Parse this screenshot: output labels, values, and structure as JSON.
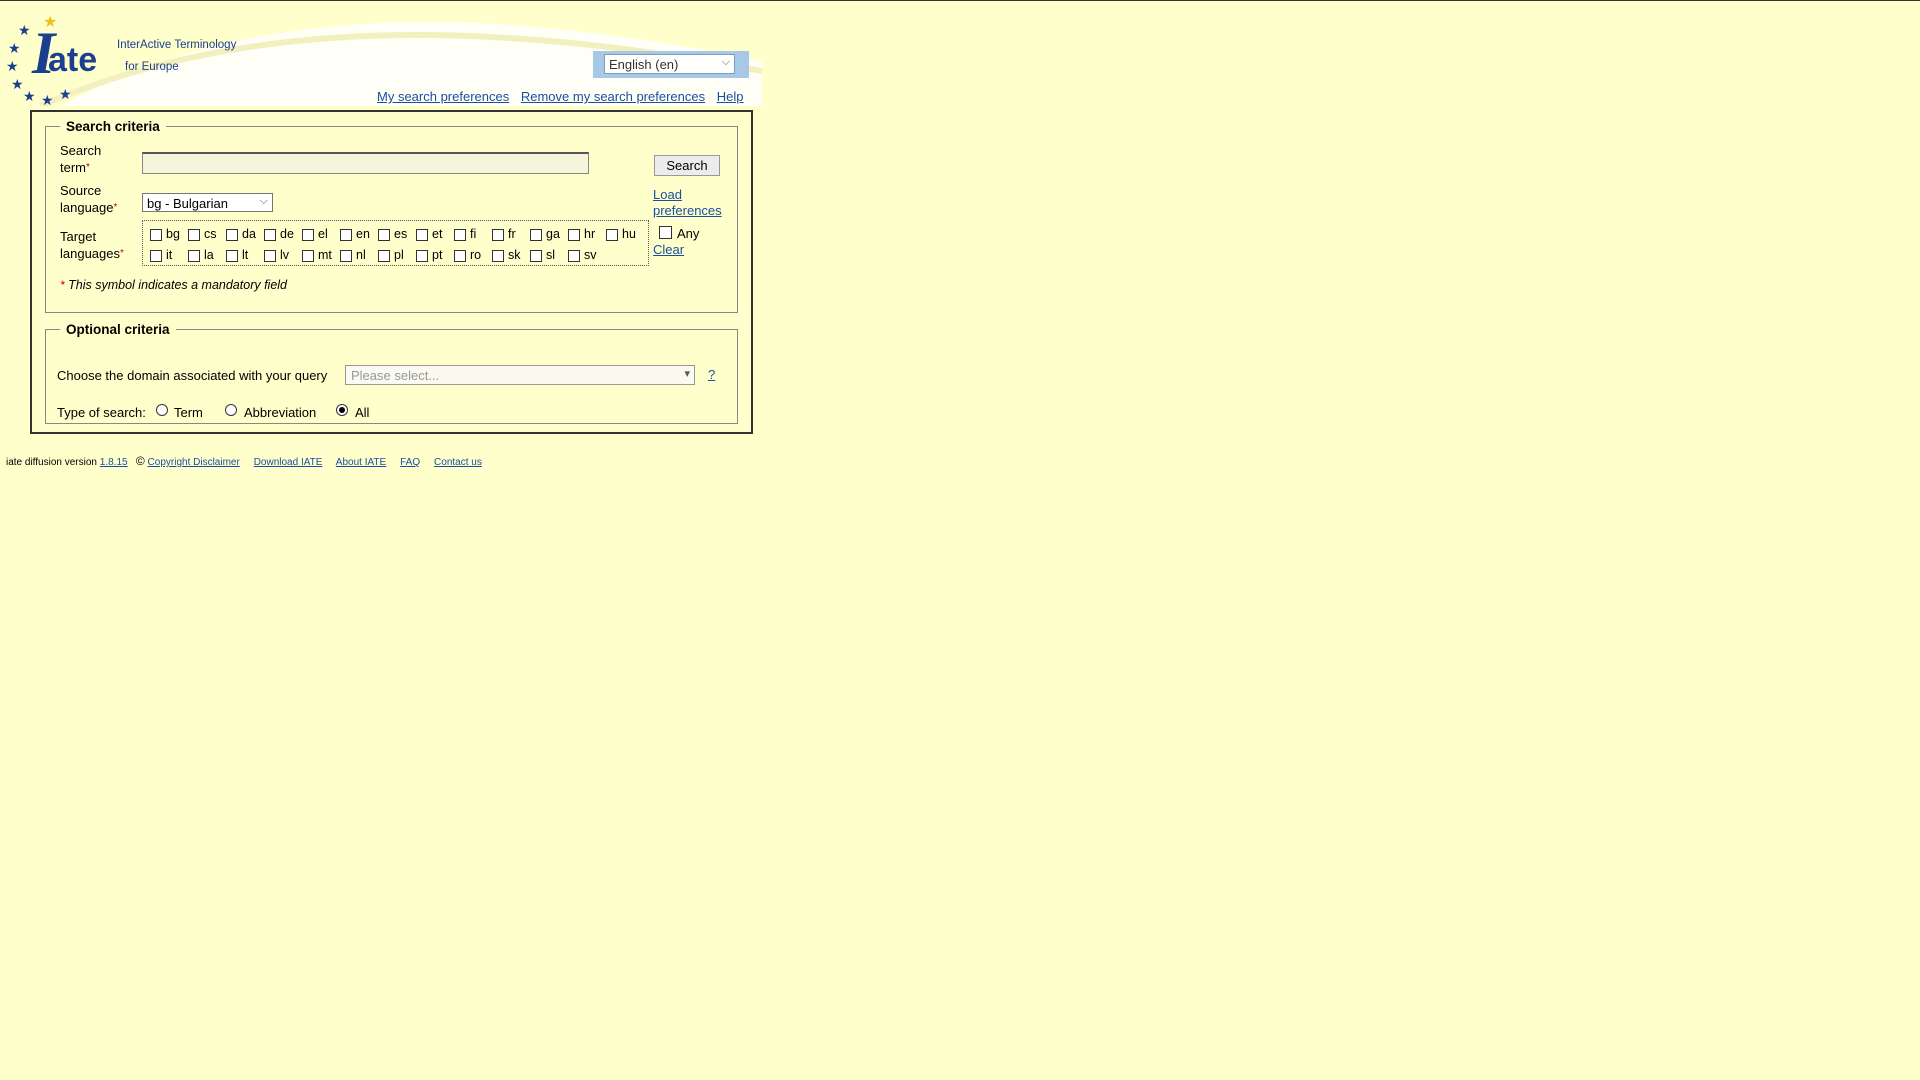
{
  "logo": {
    "mark": "Iate",
    "line1": "InterActive Terminology",
    "line2": "for Europe"
  },
  "header": {
    "language_selected": "English (en)",
    "links": [
      "My search preferences",
      "Remove my search preferences",
      "Help"
    ]
  },
  "search_criteria": {
    "legend": "Search criteria",
    "search_term_label_1": "Search",
    "search_term_label_2": "term",
    "search_term_value": "",
    "search_button": "Search",
    "source_label_1": "Source",
    "source_label_2": "language",
    "source_value": "bg - Bulgarian",
    "load_pref_1": "Load",
    "load_pref_2": "preferences",
    "target_label_1": "Target",
    "target_label_2": "languages",
    "target_row1": [
      "bg",
      "cs",
      "da",
      "de",
      "el",
      "en",
      "es",
      "et",
      "fi",
      "fr",
      "ga",
      "hr",
      "hu"
    ],
    "target_row2": [
      "it",
      "la",
      "lt",
      "lv",
      "mt",
      "nl",
      "pl",
      "pt",
      "ro",
      "sk",
      "sl",
      "sv"
    ],
    "any_label": "Any",
    "clear_label": "Clear",
    "required_mark": "*",
    "note": "This symbol indicates a mandatory field"
  },
  "optional_criteria": {
    "legend": "Optional criteria",
    "domain_label": "Choose the domain associated with your query",
    "domain_placeholder": "Please select...",
    "help_link": "?",
    "type_label": "Type of search:",
    "types": [
      {
        "label": "Term",
        "selected": false
      },
      {
        "label": "Abbreviation",
        "selected": false
      },
      {
        "label": "All",
        "selected": true
      }
    ]
  },
  "footer": {
    "version_text": "iate diffusion version",
    "version": "1.8.15",
    "copyright_symbol": "©",
    "links": [
      "Copyright Disclaimer",
      "Download IATE",
      "About IATE",
      "FAQ",
      "Contact us"
    ]
  },
  "colors": {
    "background": "#ffffcc",
    "link": "#1a4fa0",
    "logo_blue": "#1a3f8e",
    "star": "#f0c020"
  }
}
